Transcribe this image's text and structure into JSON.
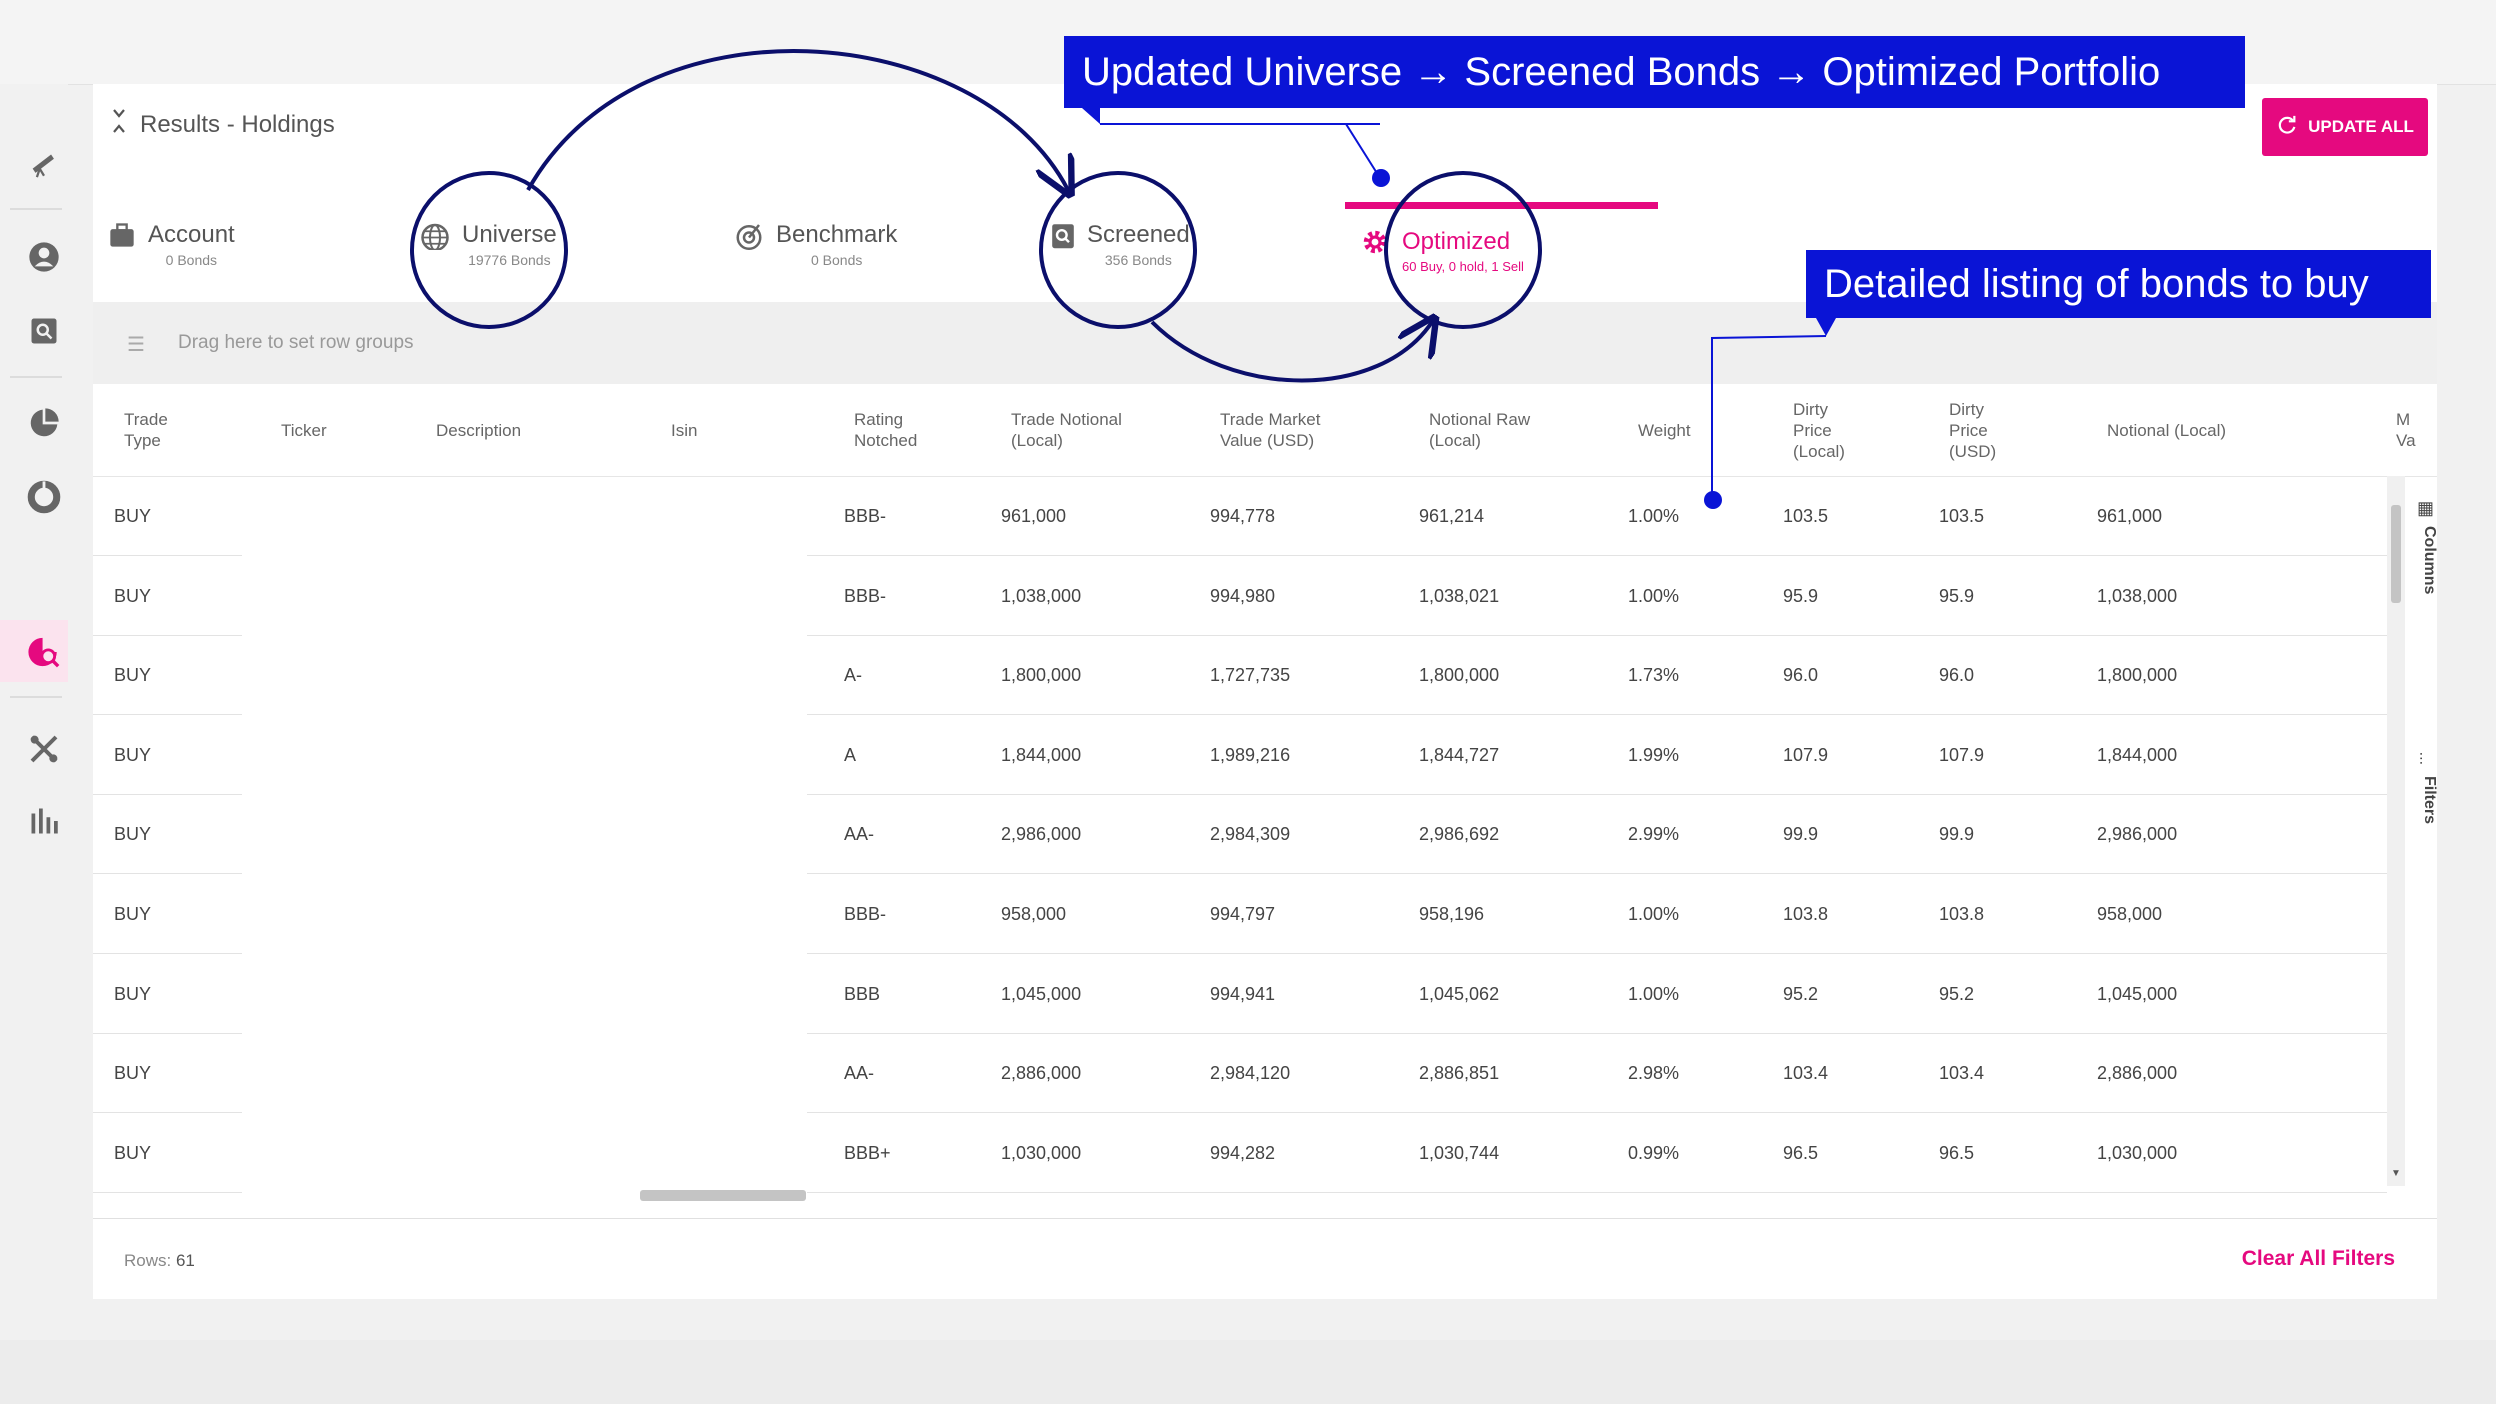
{
  "results": {
    "title": "Results - Holdings"
  },
  "update_button": {
    "label": "UPDATE ALL"
  },
  "tabs": [
    {
      "title": "Account",
      "subtitle": "0 Bonds"
    },
    {
      "title": "Universe",
      "subtitle": "19776 Bonds"
    },
    {
      "title": "Benchmark",
      "subtitle": "0 Bonds"
    },
    {
      "title": "Screened",
      "subtitle": "356 Bonds"
    },
    {
      "title": "Optimized",
      "subtitle": "60 Buy, 0 hold, 1 Sell"
    }
  ],
  "group_bar": {
    "placeholder": "Drag here to set row groups"
  },
  "columns": [
    [
      "Trade",
      "Type"
    ],
    [
      "Ticker"
    ],
    [
      "Description"
    ],
    [
      "Isin"
    ],
    [
      "Rating",
      "Notched"
    ],
    [
      "Trade Notional",
      "(Local)"
    ],
    [
      "Trade Market",
      "Value (USD)"
    ],
    [
      "Notional Raw",
      "(Local)"
    ],
    [
      "Weight"
    ],
    [
      "Dirty",
      "Price",
      "(Local)"
    ],
    [
      "Dirty",
      "Price",
      "(USD)"
    ],
    [
      "Notional (Local)"
    ],
    [
      "M",
      "Va"
    ]
  ],
  "rows": [
    {
      "trade_type": "BUY",
      "rating": "BBB-",
      "trade_notional": "961,000",
      "market_value": "994,778",
      "notional_raw": "961,214",
      "weight": "1.00%",
      "dirty_local": "103.5",
      "dirty_usd": "103.5",
      "notional_local": "961,000"
    },
    {
      "trade_type": "BUY",
      "rating": "BBB-",
      "trade_notional": "1,038,000",
      "market_value": "994,980",
      "notional_raw": "1,038,021",
      "weight": "1.00%",
      "dirty_local": "95.9",
      "dirty_usd": "95.9",
      "notional_local": "1,038,000"
    },
    {
      "trade_type": "BUY",
      "rating": "A-",
      "trade_notional": "1,800,000",
      "market_value": "1,727,735",
      "notional_raw": "1,800,000",
      "weight": "1.73%",
      "dirty_local": "96.0",
      "dirty_usd": "96.0",
      "notional_local": "1,800,000"
    },
    {
      "trade_type": "BUY",
      "rating": "A",
      "trade_notional": "1,844,000",
      "market_value": "1,989,216",
      "notional_raw": "1,844,727",
      "weight": "1.99%",
      "dirty_local": "107.9",
      "dirty_usd": "107.9",
      "notional_local": "1,844,000"
    },
    {
      "trade_type": "BUY",
      "rating": "AA-",
      "trade_notional": "2,986,000",
      "market_value": "2,984,309",
      "notional_raw": "2,986,692",
      "weight": "2.99%",
      "dirty_local": "99.9",
      "dirty_usd": "99.9",
      "notional_local": "2,986,000"
    },
    {
      "trade_type": "BUY",
      "rating": "BBB-",
      "trade_notional": "958,000",
      "market_value": "994,797",
      "notional_raw": "958,196",
      "weight": "1.00%",
      "dirty_local": "103.8",
      "dirty_usd": "103.8",
      "notional_local": "958,000"
    },
    {
      "trade_type": "BUY",
      "rating": "BBB",
      "trade_notional": "1,045,000",
      "market_value": "994,941",
      "notional_raw": "1,045,062",
      "weight": "1.00%",
      "dirty_local": "95.2",
      "dirty_usd": "95.2",
      "notional_local": "1,045,000"
    },
    {
      "trade_type": "BUY",
      "rating": "AA-",
      "trade_notional": "2,886,000",
      "market_value": "2,984,120",
      "notional_raw": "2,886,851",
      "weight": "2.98%",
      "dirty_local": "103.4",
      "dirty_usd": "103.4",
      "notional_local": "2,886,000"
    },
    {
      "trade_type": "BUY",
      "rating": "BBB+",
      "trade_notional": "1,030,000",
      "market_value": "994,282",
      "notional_raw": "1,030,744",
      "weight": "0.99%",
      "dirty_local": "96.5",
      "dirty_usd": "96.5",
      "notional_local": "1,030,000"
    }
  ],
  "side_panel": {
    "columns_label": "Columns",
    "filters_label": "Filters"
  },
  "footer": {
    "rows_label": "Rows:",
    "rows_count": "61",
    "clear_filters": "Clear All Filters"
  },
  "callouts": {
    "flow": "Updated Universe  →  Screened Bonds → Optimized Portfolio",
    "detail": "Detailed listing of bonds to buy"
  },
  "colors": {
    "accent": "#e5097f",
    "callout": "#0a14d6",
    "annotation": "#0b0f6b"
  }
}
